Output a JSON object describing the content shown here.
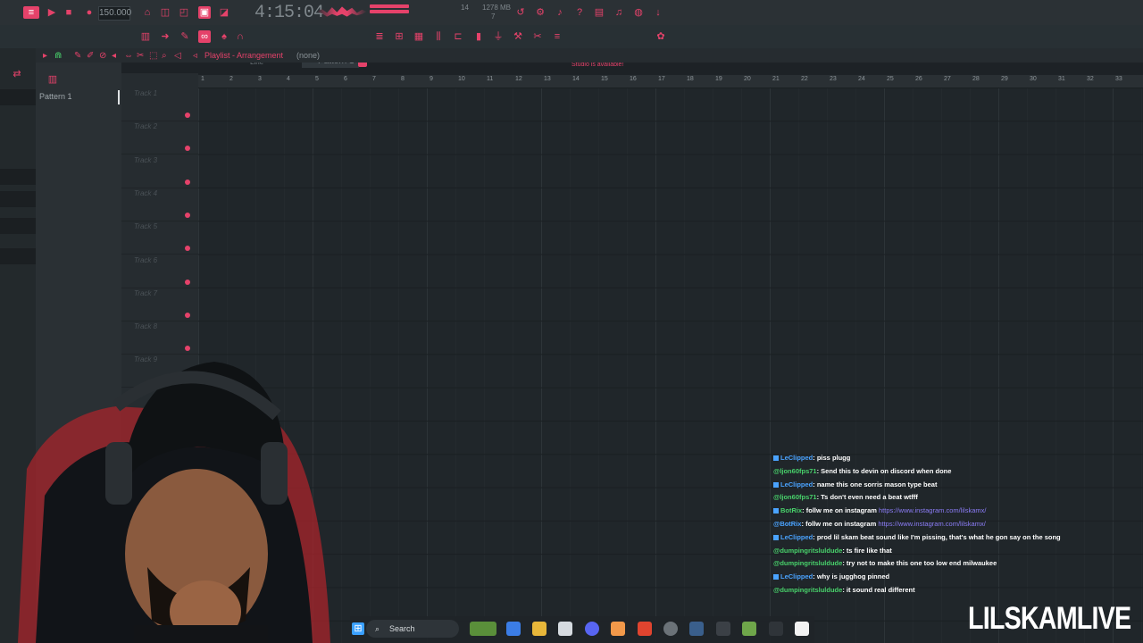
{
  "toolbar": {
    "tempo": "150.000",
    "clock": "4:15:04",
    "cpu_top": "14",
    "memory": "1278 MB",
    "cpu_bottom": "7",
    "snap_label": "Line",
    "pattern_label": "Pattern 1",
    "news": "Today: A newer version of FL Studio is available!"
  },
  "playlist": {
    "title": "Playlist - Arrangement",
    "selection": "(none)",
    "pattern_item": "Pattern 1",
    "tracks": [
      "Track 1",
      "Track 2",
      "Track 3",
      "Track 4",
      "Track 5",
      "Track 6",
      "Track 7",
      "Track 8",
      "Track 9"
    ],
    "bars": [
      "1",
      "2",
      "3",
      "4",
      "5",
      "6",
      "7",
      "8",
      "9",
      "10",
      "11",
      "12",
      "13",
      "14",
      "15",
      "16",
      "17",
      "18",
      "19",
      "20",
      "21",
      "22",
      "23",
      "24",
      "25",
      "26",
      "27",
      "28",
      "29",
      "30",
      "31",
      "32",
      "33"
    ]
  },
  "chat": [
    {
      "user": "LeClipped",
      "user_color": "#4aa3ff",
      "badges": true,
      "message": ": piss plugg",
      "link": ""
    },
    {
      "user": "@ljon60fps71",
      "user_color": "#48d26b",
      "badges": false,
      "message": ": Send this to devin on discord when done",
      "link": ""
    },
    {
      "user": "LeClipped",
      "user_color": "#4aa3ff",
      "badges": true,
      "message": ": name this one sorris mason type beat",
      "link": ""
    },
    {
      "user": "@ljon60fps71",
      "user_color": "#48d26b",
      "badges": false,
      "message": ": Ts don't even need a beat wtfff",
      "link": ""
    },
    {
      "user": "BotRix",
      "user_color": "#48d26b",
      "badges": true,
      "message": ": follw me on instagram ",
      "link": "https://www.instagram.com/lilskamx/"
    },
    {
      "user": "@BotRix",
      "user_color": "#4aa3ff",
      "badges": false,
      "message": ": follw me on instagram ",
      "link": "https://www.instagram.com/lilskamx/"
    },
    {
      "user": "LeClipped",
      "user_color": "#4aa3ff",
      "badges": true,
      "message": ": prod lil skam beat sound like I'm pissing, that's what he gon say on the song",
      "link": ""
    },
    {
      "user": "@dumpingritsluldude",
      "user_color": "#48d26b",
      "badges": false,
      "message": ": ts fire like that",
      "link": ""
    },
    {
      "user": "@dumpingritsluldude",
      "user_color": "#48d26b",
      "badges": false,
      "message": ": try not to make this one too low end milwaukee",
      "link": ""
    },
    {
      "user": "LeClipped",
      "user_color": "#4aa3ff",
      "badges": true,
      "message": ": why is jugghog pinned",
      "link": ""
    },
    {
      "user": "@dumpingritsluldude",
      "user_color": "#48d26b",
      "badges": false,
      "message": ": it sound real different",
      "link": ""
    }
  ],
  "brand": "LILSKAMLIVE",
  "taskbar": {
    "search_label": "Search"
  },
  "colors": {
    "accent": "#e5426a",
    "background": "#1d2226",
    "chat_user_blue": "#4aa3ff",
    "chat_user_green": "#48d26b",
    "link": "#8b7cf6"
  }
}
